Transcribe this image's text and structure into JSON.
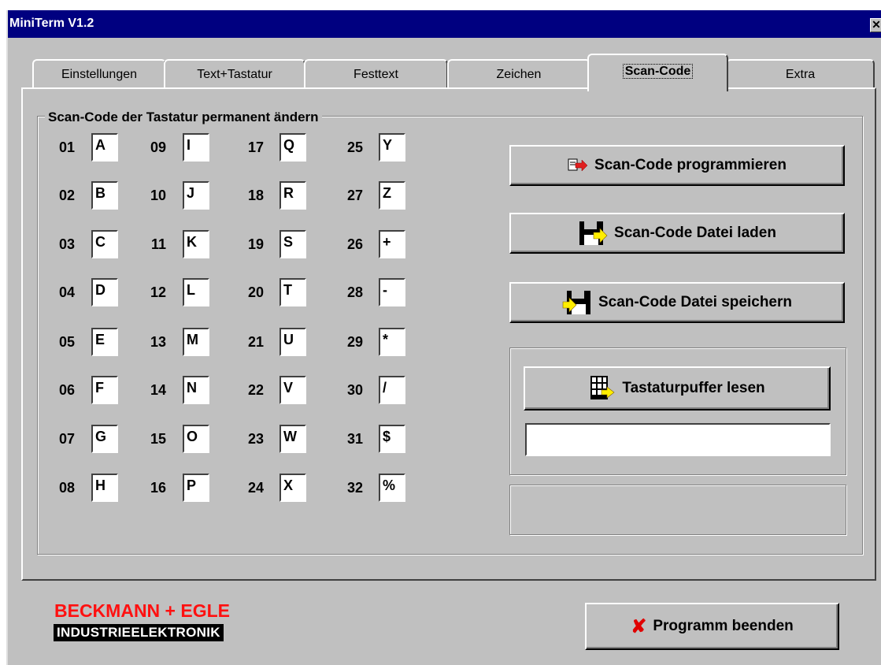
{
  "window": {
    "title": "MiniTerm V1.2",
    "close_symbol": "✕"
  },
  "tabs": [
    {
      "label": "Einstellungen",
      "active": false
    },
    {
      "label": "Text+Tastatur",
      "active": false
    },
    {
      "label": "Festtext",
      "active": false
    },
    {
      "label": "Zeichen",
      "active": false
    },
    {
      "label": "Scan-Code",
      "active": true
    },
    {
      "label": "Extra",
      "active": false
    }
  ],
  "group_title": "Scan-Code der Tastatur permanent ändern",
  "scan_codes": [
    [
      {
        "num": "01",
        "char": "A"
      },
      {
        "num": "02",
        "char": "B"
      },
      {
        "num": "03",
        "char": "C"
      },
      {
        "num": "04",
        "char": "D"
      },
      {
        "num": "05",
        "char": "E"
      },
      {
        "num": "06",
        "char": "F"
      },
      {
        "num": "07",
        "char": "G"
      },
      {
        "num": "08",
        "char": "H"
      }
    ],
    [
      {
        "num": "09",
        "char": "I"
      },
      {
        "num": "10",
        "char": "J"
      },
      {
        "num": "11",
        "char": "K"
      },
      {
        "num": "12",
        "char": "L"
      },
      {
        "num": "13",
        "char": "M"
      },
      {
        "num": "14",
        "char": "N"
      },
      {
        "num": "15",
        "char": "O"
      },
      {
        "num": "16",
        "char": "P"
      }
    ],
    [
      {
        "num": "17",
        "char": "Q"
      },
      {
        "num": "18",
        "char": "R"
      },
      {
        "num": "19",
        "char": "S"
      },
      {
        "num": "20",
        "char": "T"
      },
      {
        "num": "21",
        "char": "U"
      },
      {
        "num": "22",
        "char": "V"
      },
      {
        "num": "23",
        "char": "W"
      },
      {
        "num": "24",
        "char": "X"
      }
    ],
    [
      {
        "num": "25",
        "char": "Y"
      },
      {
        "num": "27",
        "char": "Z"
      },
      {
        "num": "26",
        "char": "+"
      },
      {
        "num": "28",
        "char": "-"
      },
      {
        "num": "29",
        "char": "*"
      },
      {
        "num": "30",
        "char": "/"
      },
      {
        "num": "31",
        "char": "$"
      },
      {
        "num": "32",
        "char": "%"
      }
    ]
  ],
  "buttons": {
    "program": {
      "label": "Scan-Code programmieren",
      "icon": "file-arrow-icon"
    },
    "load": {
      "label": "Scan-Code Datei laden",
      "icon": "floppy-load-icon"
    },
    "save": {
      "label": "Scan-Code Datei speichern",
      "icon": "floppy-save-icon"
    },
    "read_buffer": {
      "label": "Tastaturpuffer lesen",
      "icon": "keypad-icon"
    },
    "exit": {
      "label": "Programm beenden",
      "icon": "red-x-icon"
    }
  },
  "buffer_value": "",
  "logo": {
    "line1": "BECKMANN + EGLE",
    "line2": "INDUSTRIEELEKTRONIK"
  },
  "colors": {
    "titlebar": "#000080",
    "face": "#c0c0c0",
    "logo_red": "#ff1010",
    "exit_x": "#e00000"
  }
}
